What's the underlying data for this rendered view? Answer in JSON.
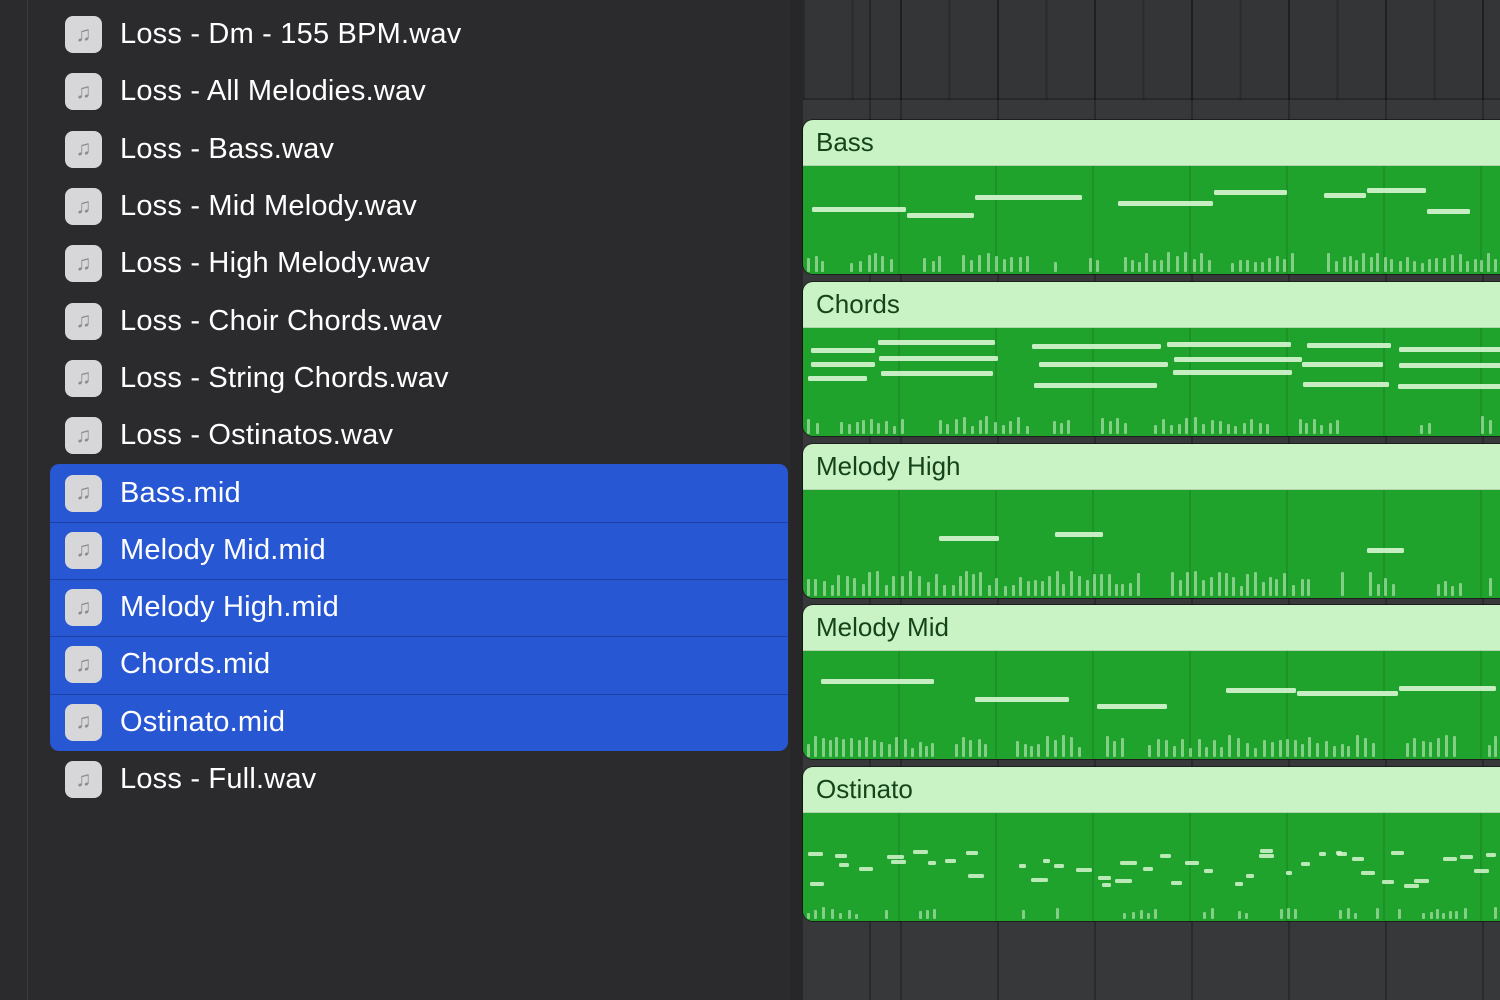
{
  "colors": {
    "selection_blue": "#2857d4",
    "panel_bg": "#2b2b2d",
    "track_bg": "#37383a",
    "track_gutter": "#27272a",
    "region_header_green": "#c9f3c5",
    "region_body_green": "#1fa32c",
    "region_name_text": "#15441b",
    "note_light_green": "#d6f4d0",
    "file_text": "#ffffff",
    "icon_bg": "#d7d7d9",
    "icon_glyph_color": "#8a8a8f"
  },
  "file_list": {
    "icon_glyph": "♫",
    "items": [
      {
        "label": "Loss - Dm - 155 BPM.wav",
        "selected": false
      },
      {
        "label": "Loss - All Melodies.wav",
        "selected": false
      },
      {
        "label": "Loss - Bass.wav",
        "selected": false
      },
      {
        "label": "Loss - Mid Melody.wav",
        "selected": false
      },
      {
        "label": "Loss - High Melody.wav",
        "selected": false
      },
      {
        "label": "Loss - Choir Chords.wav",
        "selected": false
      },
      {
        "label": "Loss - String Chords.wav",
        "selected": false
      },
      {
        "label": "Loss - Ostinatos.wav",
        "selected": false
      },
      {
        "label": "Bass.mid",
        "selected": true
      },
      {
        "label": "Melody Mid.mid",
        "selected": true
      },
      {
        "label": "Melody High.mid",
        "selected": true
      },
      {
        "label": "Chords.mid",
        "selected": true
      },
      {
        "label": "Ostinato.mid",
        "selected": true
      },
      {
        "label": "Loss - Full.wav",
        "selected": false
      }
    ]
  },
  "timeline": {
    "regions": [
      {
        "name": "Bass",
        "pattern": "bass",
        "seed": 101
      },
      {
        "name": "Chords",
        "pattern": "chords",
        "seed": 202
      },
      {
        "name": "Melody High",
        "pattern": "melodyHigh",
        "seed": 303
      },
      {
        "name": "Melody Mid",
        "pattern": "melodyMid",
        "seed": 404
      },
      {
        "name": "Ostinato",
        "pattern": "ostinato",
        "seed": 505
      }
    ]
  }
}
